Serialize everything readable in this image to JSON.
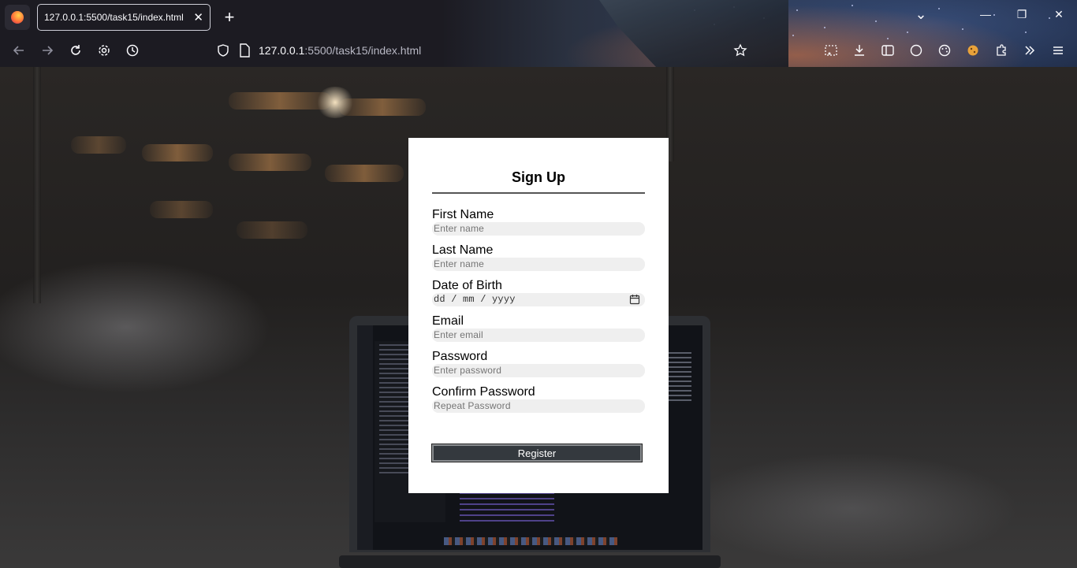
{
  "browser": {
    "tab_title": "127.0.0.1:5500/task15/index.html",
    "tab_close": "✕",
    "new_tab": "+",
    "url_host": "127.0.0.1",
    "url_rest": ":5500/task15/index.html",
    "window_controls": {
      "list": "⌄",
      "minimize": "—",
      "restore": "❐",
      "close": "✕"
    }
  },
  "form": {
    "title": "Sign Up",
    "fields": [
      {
        "label": "First Name",
        "placeholder": "Enter name"
      },
      {
        "label": "Last Name",
        "placeholder": "Enter name"
      },
      {
        "label": "Date of Birth",
        "placeholder": "dd / mm / yyyy"
      },
      {
        "label": "Email",
        "placeholder": "Enter email"
      },
      {
        "label": "Password",
        "placeholder": "Enter password"
      },
      {
        "label": "Confirm Password",
        "placeholder": "Repeat Password"
      }
    ],
    "submit_label": "Register"
  },
  "colors": {
    "card_bg": "#ffffff",
    "input_bg": "#efefef",
    "button_bg": "#34393e",
    "chrome_bg": "#1c1b22"
  }
}
